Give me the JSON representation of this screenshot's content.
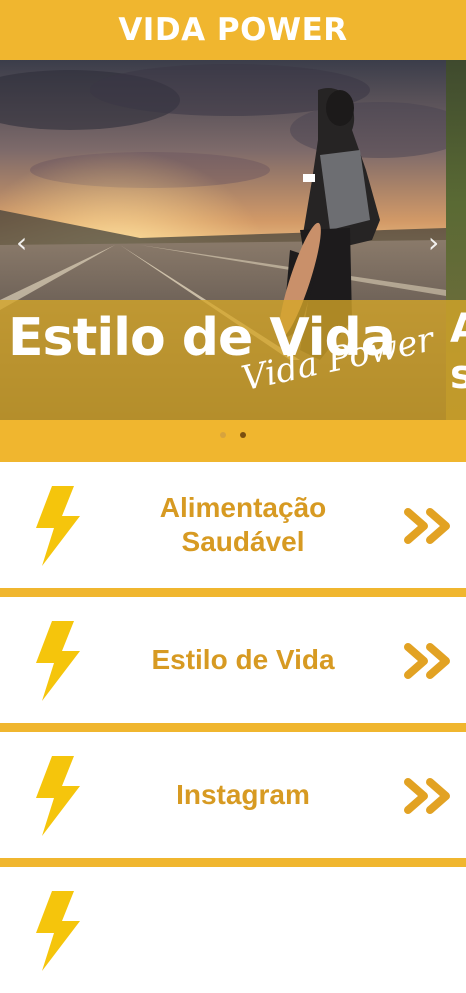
{
  "app": {
    "title": "VIDA POWER"
  },
  "carousel": {
    "current_slide": {
      "caption_title": "Estilo de Vida",
      "caption_subtitle": "Vida Power"
    },
    "next_slide_peek": {
      "caption_fragment": "A\ns"
    },
    "prev_label": "‹",
    "next_label": "›",
    "dots": [
      {
        "active": false
      },
      {
        "active": true
      }
    ]
  },
  "menu": {
    "items": [
      {
        "label": "Alimentação Saudável",
        "icon": "lightning-bolt-icon",
        "action_icon": "double-chevron-right-icon"
      },
      {
        "label": "Estilo de Vida",
        "icon": "lightning-bolt-icon",
        "action_icon": "double-chevron-right-icon"
      },
      {
        "label": "Instagram",
        "icon": "lightning-bolt-icon",
        "action_icon": "double-chevron-right-icon"
      },
      {
        "label": "",
        "icon": "lightning-bolt-icon",
        "action_icon": "double-chevron-right-icon"
      }
    ]
  },
  "colors": {
    "brand_yellow": "#F0B62F",
    "icon_yellow": "#F5C50C",
    "label_gold": "#D79A22",
    "active_dot": "#7A4E10"
  }
}
